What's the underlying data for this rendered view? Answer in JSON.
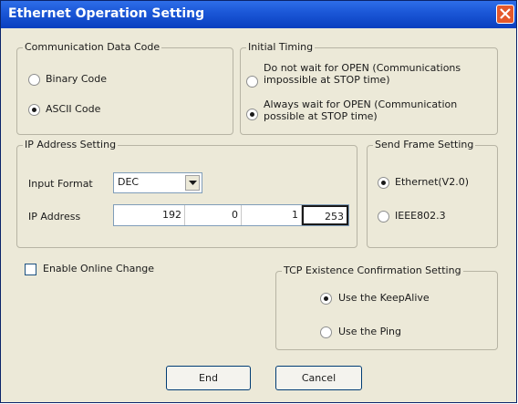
{
  "window": {
    "title": "Ethernet Operation Setting"
  },
  "communication_data_code": {
    "legend": "Communication Data Code",
    "options": [
      {
        "label": "Binary Code",
        "selected": false
      },
      {
        "label": "ASCII Code",
        "selected": true
      }
    ]
  },
  "initial_timing": {
    "legend": "Initial Timing",
    "options": [
      {
        "line1": "Do not wait for OPEN (Communications",
        "line2": "impossible at STOP time)",
        "selected": false
      },
      {
        "line1": "Always wait for OPEN (Communication",
        "line2": "possible at STOP time)",
        "selected": true
      }
    ]
  },
  "ip_address_setting": {
    "legend": "IP Address Setting",
    "input_format_label": "Input Format",
    "input_format_value": "DEC",
    "ip_address_label": "IP Address",
    "octets": [
      "192",
      "0",
      "1",
      "253"
    ]
  },
  "send_frame_setting": {
    "legend": "Send Frame Setting",
    "options": [
      {
        "label": "Ethernet(V2.0)",
        "selected": true
      },
      {
        "label": "IEEE802.3",
        "selected": false
      }
    ]
  },
  "enable_online_change": {
    "label": "Enable Online Change",
    "checked": false
  },
  "tcp_existence": {
    "legend": "TCP Existence Confirmation Setting",
    "options": [
      {
        "label": "Use the KeepAlive",
        "selected": true
      },
      {
        "label": "Use the Ping",
        "selected": false
      }
    ]
  },
  "buttons": {
    "end": "End",
    "cancel": "Cancel"
  },
  "colors": {
    "titlebar": "#0a3fbf",
    "dialog_bg": "#ece9d8",
    "close_button": "#e4582b"
  }
}
